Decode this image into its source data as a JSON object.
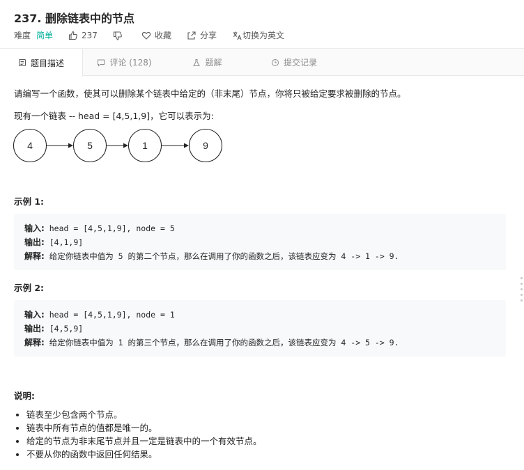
{
  "header": {
    "title": "237. 删除链表中的节点",
    "difficulty_label": "难度",
    "difficulty_value": "简单",
    "likes": "237",
    "favorite": "收藏",
    "share": "分享",
    "translate": "切换为英文"
  },
  "tabs": [
    {
      "label": "题目描述"
    },
    {
      "label": "评论 (128)"
    },
    {
      "label": "题解"
    },
    {
      "label": "提交记录"
    }
  ],
  "description": {
    "intro": "请编写一个函数，使其可以删除某个链表中给定的（非末尾）节点，你将只被给定要求被删除的节点。",
    "list_intro": "现有一个链表 -- head = [4,5,1,9]，它可以表示为:",
    "nodes": [
      "4",
      "5",
      "1",
      "9"
    ]
  },
  "example1": {
    "title": "示例 1:",
    "input_label": "输入:",
    "input": " head = [4,5,1,9], node = 5",
    "output_label": "输出:",
    "output": " [4,1,9]",
    "explain_label": "解释:",
    "explain": " 给定你链表中值为 5 的第二个节点，那么在调用了你的函数之后，该链表应变为 4 -> 1 -> 9."
  },
  "example2": {
    "title": "示例 2:",
    "input_label": "输入:",
    "input": " head = [4,5,1,9], node = 1",
    "output_label": "输出:",
    "output": " [4,5,9]",
    "explain_label": "解释:",
    "explain": " 给定你链表中值为 1 的第三个节点，那么在调用了你的函数之后，该链表应变为 4 -> 5 -> 9."
  },
  "notes": {
    "title": "说明:",
    "items": [
      "链表至少包含两个节点。",
      "链表中所有节点的值都是唯一的。",
      "给定的节点为非末尾节点并且一定是链表中的一个有效节点。",
      "不要从你的函数中返回任何结果。"
    ]
  },
  "colors": {
    "accent_green": "#00af9b",
    "code_bg": "#f7f9fa"
  }
}
